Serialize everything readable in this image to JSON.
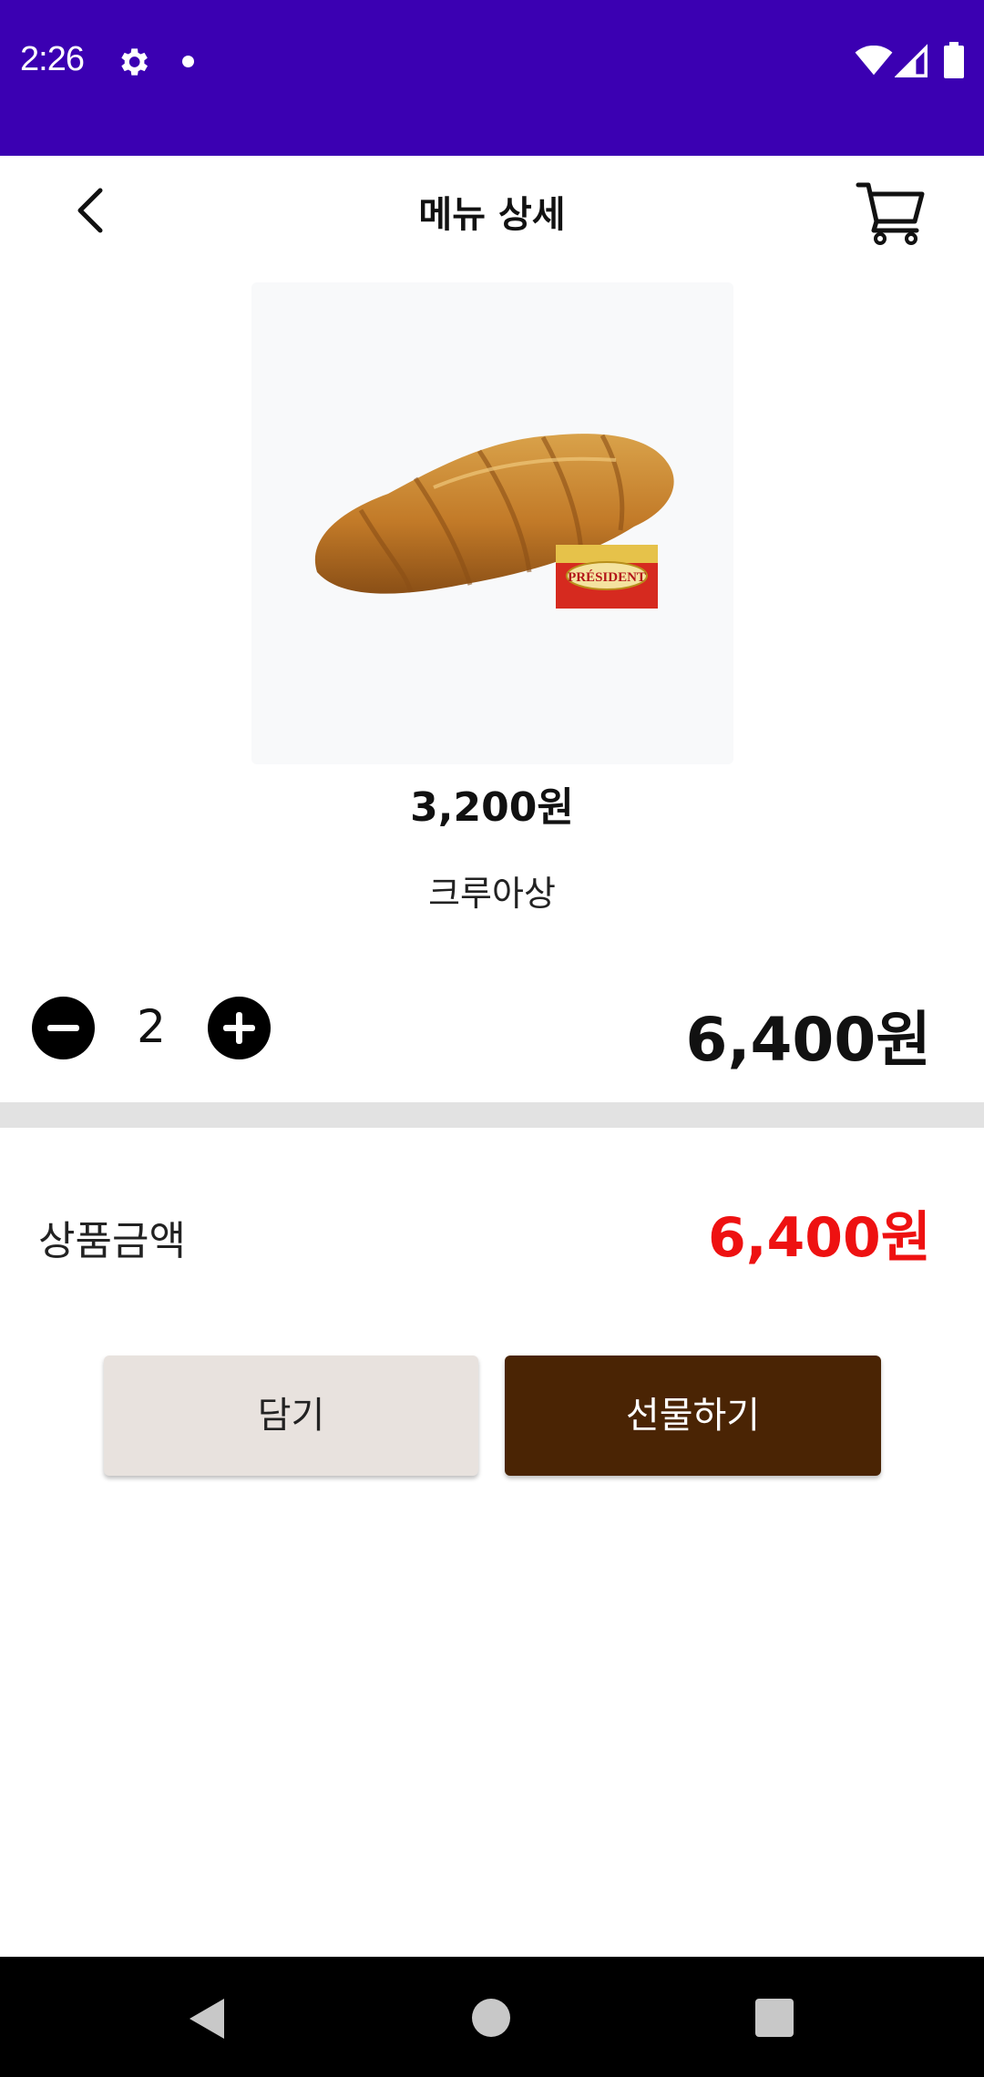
{
  "status_bar": {
    "time": "2:26",
    "background": "#3b00b2",
    "icons": [
      "gear-icon",
      "notification-dot-icon",
      "wifi-icon",
      "signal-icon",
      "battery-icon"
    ]
  },
  "app_bar": {
    "title": "메뉴 상세",
    "back_icon": "chevron-left-icon",
    "cart_icon": "cart-icon"
  },
  "product": {
    "image_label": "PRÉSIDENT",
    "unit_price": "3,200원",
    "name": "크루아상"
  },
  "quantity": {
    "value": "2",
    "line_total": "6,400원",
    "minus_icon": "minus-circle-icon",
    "plus_icon": "plus-circle-icon"
  },
  "summary": {
    "label": "상품금액",
    "amount": "6,400원",
    "amount_color": "#ee1111"
  },
  "actions": {
    "add_label": "담기",
    "gift_label": "선물하기",
    "add_color": "#e8e2de",
    "gift_color": "#4a2404"
  },
  "nav_bar": {
    "icons": [
      "back-triangle-icon",
      "home-circle-icon",
      "recents-square-icon"
    ]
  }
}
